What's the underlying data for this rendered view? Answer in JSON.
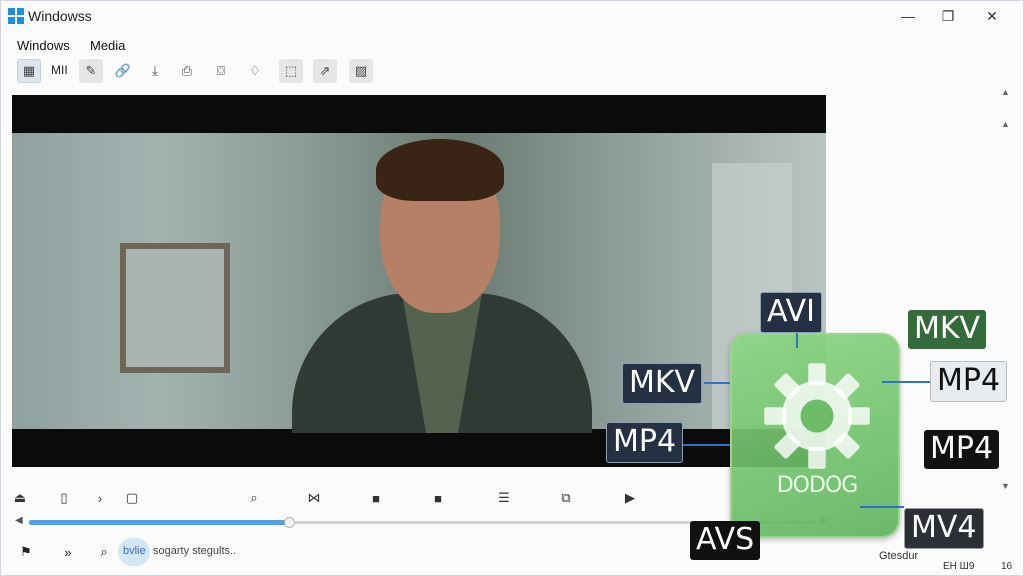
{
  "window": {
    "title": "Windowss",
    "controls": {
      "minimize": "—",
      "maximize": "❐",
      "close": "✕"
    }
  },
  "menu": [
    "Windows",
    "Media"
  ],
  "toolbar": {
    "label": "MII",
    "icons": [
      "grid-icon",
      "pencil-icon",
      "link-icon",
      "download-icon",
      "printer-icon",
      "camera-icon",
      "bulb-icon",
      "crop-icon",
      "export-icon",
      "gallery-icon"
    ]
  },
  "controls": {
    "icons": [
      "eject-icon",
      "file-icon",
      "next-icon",
      "chat-icon",
      "search-icon",
      "bowtie-icon",
      "record-icon",
      "camera-icon",
      "list-icon",
      "shuffle-icon",
      "play-skip-icon"
    ]
  },
  "seek": {
    "progress": 0.33
  },
  "bottom": {
    "chip": "bvlie",
    "status": "sogarty stegults..",
    "corner_label": "Gtesdur",
    "corner_left": "ЕН Ш9",
    "corner_right": "16"
  },
  "formats": {
    "avi": "AVI",
    "mkv_left": "MKV",
    "mp4_left": "MP4",
    "mkv_right": "MKV",
    "mp4_right": "MP4",
    "mp4_right2": "MP4",
    "mv4": "MV4",
    "avs": "AVS",
    "brand": "DODOG"
  },
  "colors": {
    "accent": "#5aa0e0",
    "overlay_green": "#6cc46a"
  }
}
